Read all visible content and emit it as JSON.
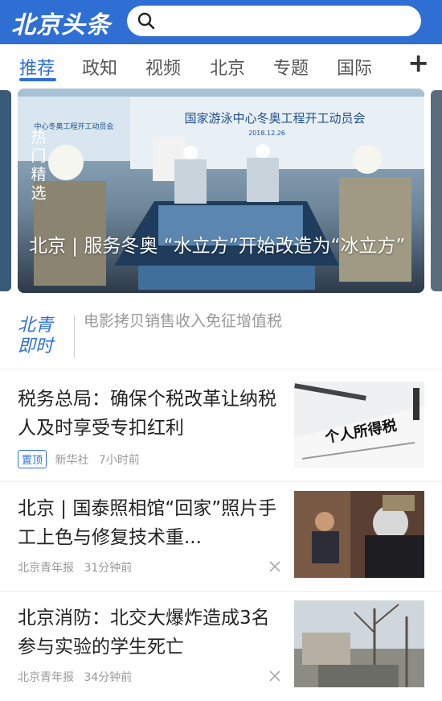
{
  "app": {
    "logo_text": "北京头条",
    "accent_color": "#2f6fd4"
  },
  "search": {
    "icon": "search-icon",
    "placeholder": ""
  },
  "tabs": [
    {
      "label": "推荐",
      "active": true
    },
    {
      "label": "政知",
      "active": false
    },
    {
      "label": "视频",
      "active": false
    },
    {
      "label": "北京",
      "active": false
    },
    {
      "label": "专题",
      "active": false
    },
    {
      "label": "国际",
      "active": false
    }
  ],
  "add_tab_label": "+",
  "hero": {
    "tag": "热门精选",
    "title": "北京 | 服务冬奥 “水立方”开始改造为“冰立方”",
    "image_banner_text": "国家游泳中心冬奥工程开工动员会",
    "image_banner_left_text": "中心冬奥工程开工动员会",
    "image_banner_date": "2018.12.26"
  },
  "beiqing": {
    "logo_text": "北青 即时",
    "ticker": "电影拷贝销售收入免征增值税"
  },
  "news": [
    {
      "title": "税务总局：确保个税改革让纳税人及时享受专扣红利",
      "badge": "置顶",
      "source": "新华社",
      "time": "7小时前",
      "thumb_text": "个人所得税",
      "has_close": false
    },
    {
      "title": "北京 | 国泰照相馆“回家”照片手工上色与修复技术重...",
      "badge": "",
      "source": "北京青年报",
      "time": "31分钟前",
      "thumb_text": "",
      "has_close": true
    },
    {
      "title": "北京消防：北交大爆炸造成3名参与实验的学生死亡",
      "badge": "",
      "source": "北京青年报",
      "time": "34分钟前",
      "thumb_text": "",
      "has_close": true
    }
  ]
}
